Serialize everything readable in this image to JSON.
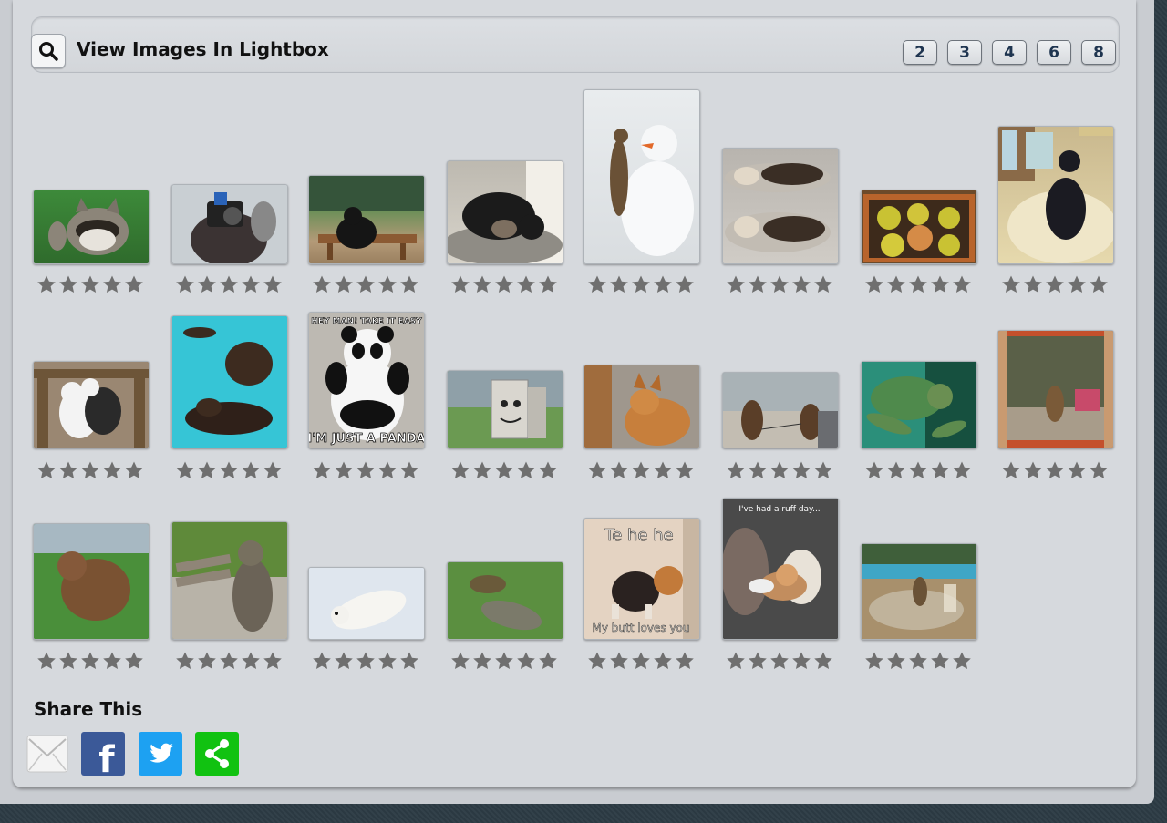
{
  "lightbox": {
    "title": "View Images In Lightbox",
    "search_icon": "magnifier-icon",
    "pages": [
      "2",
      "3",
      "4",
      "6",
      "8"
    ]
  },
  "gallery": {
    "rating_icon": "star-icon",
    "thumbnails": [
      {
        "subject": "raccoon waving"
      },
      {
        "subject": "photographer with camera"
      },
      {
        "subject": "bear at picnic table"
      },
      {
        "subject": "bear resting on rock"
      },
      {
        "subject": "meerkat with snowman"
      },
      {
        "subject": "sea otters floating"
      },
      {
        "subject": "ducklings in box"
      },
      {
        "subject": "dog on sofa"
      },
      {
        "subject": "pandas on fence"
      },
      {
        "subject": "dogs swimming in pool"
      },
      {
        "subject": "panda meme",
        "top_text": "HEY MAN! TAKE IT EASY",
        "bottom_text": "I'M JUST A PANDA"
      },
      {
        "subject": "box with drawn face"
      },
      {
        "subject": "fox by window"
      },
      {
        "subject": "bear cubs on beach"
      },
      {
        "subject": "sea turtle"
      },
      {
        "subject": "animal in doorway"
      },
      {
        "subject": "wombat on grass"
      },
      {
        "subject": "raccoon at bench"
      },
      {
        "subject": "polar bear cub in snow"
      },
      {
        "subject": "turtle with crocodile"
      },
      {
        "subject": "corgi meme",
        "top_text": "Te he he",
        "bottom_text": "My butt loves you"
      },
      {
        "subject": "dog on couch meme",
        "top_text": "I've had a ruff day..."
      },
      {
        "subject": "squirrel on poolside table"
      }
    ]
  },
  "share": {
    "title": "Share This",
    "icons": [
      "email-icon",
      "facebook-icon",
      "twitter-icon",
      "share-icon"
    ],
    "facebook_letter": "f",
    "colors": {
      "facebook": "#3b5998",
      "twitter": "#1da1f2",
      "share": "#11c211"
    }
  }
}
